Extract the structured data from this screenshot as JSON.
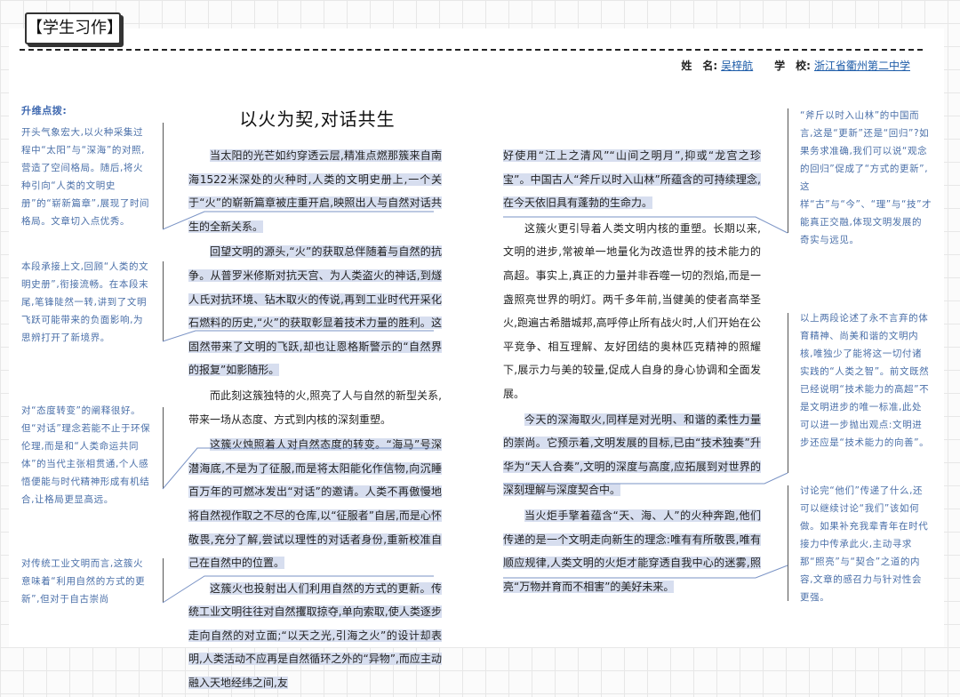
{
  "tag": "【学生习作】",
  "meta": {
    "name_label": "姓　名:",
    "name": "吴梓航",
    "school_label": "学　校:",
    "school": "浙江省衢州第二中学"
  },
  "title": "以火为契,对话共生",
  "left_notes": {
    "heading": "升维点拨:",
    "n1": "开头气象宏大,以火种采集过程中“太阳”与“深海”的对照,营造了空间格局。随后,将火种引向“人类的文明史册”的“崭新篇章”,展现了时间格局。文章切入点优秀。",
    "n2": "本段承接上文,回顾“人类的文明史册”,衔接流畅。在本段末尾,笔锋陡然一转,讲到了文明飞跃可能带来的负面影响,为思辨打开了新境界。",
    "n3": "对“态度转变”的阐释很好。但“对话”理念若能不止于环保伦理,而是和“人类命运共同体”的当代主张相贯通,个人感悟便能与时代精神形成有机结合,让格局更显高远。",
    "n4": "对传统工业文明而言,这簇火意味着“利用自然的方式的更新”,但对于自古崇尚"
  },
  "right_notes": {
    "n1": "“斧斤以时入山林”的中国而言,这是“更新”还是“回归”?如果务求准确,我们可以说“观念的回归”促成了“方式的更新”,这样“古”与“今”、“理”与“技”才能真正交融,体现文明发展的奇实与远见。",
    "n2": "以上两段论述了永不言弃的体育精神、尚美和谐的文明内核,唯独少了能将这一切付诸实践的“人类之智”。前文既然已经说明“技术能力的高超”不是文明进步的唯一标准,此处可以进一步抛出观点:文明进步还应是“技术能力的向善”。",
    "n3": "讨论完“他们”传递了什么,还可以继续讨论“我们”该如何做。如果补充我辈青年在时代接力中传承此火,主动寻求那“照亮”与“契合”之道的内容,文章的感召力与针对性会更强。"
  },
  "col1": [
    "当太阳的光芒如约穿透云层,精准点燃那簇来自南海1522米深处的火种时,人类的文明史册上,一个关于“火”的崭新篇章被庄重开启,映照出人与自然对话共生的全新关系。",
    "回望文明的源头,“火”的获取总伴随着与自然的抗争。从普罗米修斯对抗天宫、为人类盗火的神话,到燧人氏对抗环境、钻木取火的传说,再到工业时代开采化石燃料的历史,“火”的获取彰显着技术力量的胜利。这固然带来了文明的飞跃,却也让恩格斯警示的“自然界的报复”如影随形。",
    "而此刻这簇独特的火,照亮了人与自然的新型关系,带来一场从态度、方式到内核的深刻重塑。",
    "这簇火烛照着人对自然态度的转变。“海马”号深潜海底,不是为了征服,而是将太阳能化作信物,向沉睡百万年的可燃冰发出“对话”的邀请。人类不再傲慢地将自然视作取之不尽的仓库,以“征服者”自居,而是心怀敬畏,充分了解,尝试以理性的对话者身份,重新校准自己在自然中的位置。",
    "这簇火也投射出人们利用自然的方式的更新。传统工业文明往往对自然攫取掠夺,单向索取,使人类逐步走向自然的对立面;“以天之光,引海之火”的设计却表明,人类活动不应再是自然循环之外的“异物”,而应主动融入天地经纬之间,友"
  ],
  "col2": [
    "好使用“江上之清风”“山间之明月”,抑或“龙宫之珍宝”。中国古人“斧斤以时入山林”所蕴含的可持续理念,在今天依旧具有蓬勃的生命力。",
    "这簇火更引导着人类文明内核的重塑。长期以来,文明的进步,常被单一地量化为改造世界的技术能力的高超。事实上,真正的力量并非吞噬一切的烈焰,而是一盏照亮世界的明灯。两千多年前,当健美的使者高举圣火,跑遍古希腊城邦,高呼停止所有战火时,人们开始在公平竞争、相互理解、友好团结的奥林匹克精神的照耀下,展示力与美的较量,促成人自身的身心协调和全面发展。",
    "今天的深海取火,同样是对光明、和谐的柔性力量的崇尚。它预示着,文明发展的目标,已由“技术独奏”升华为“天人合奏”,文明的深度与高度,应拓展到对世界的深刻理解与深度契合中。",
    "当火炬手擎着蕴含“天、海、人”的火种奔跑,他们传递的是一个文明走向新生的理念:唯有有所敬畏,唯有顺应规律,人类文明的火炬才能穿透自我中心的迷雾,照亮“万物并育而不相害”的美好未来。"
  ]
}
